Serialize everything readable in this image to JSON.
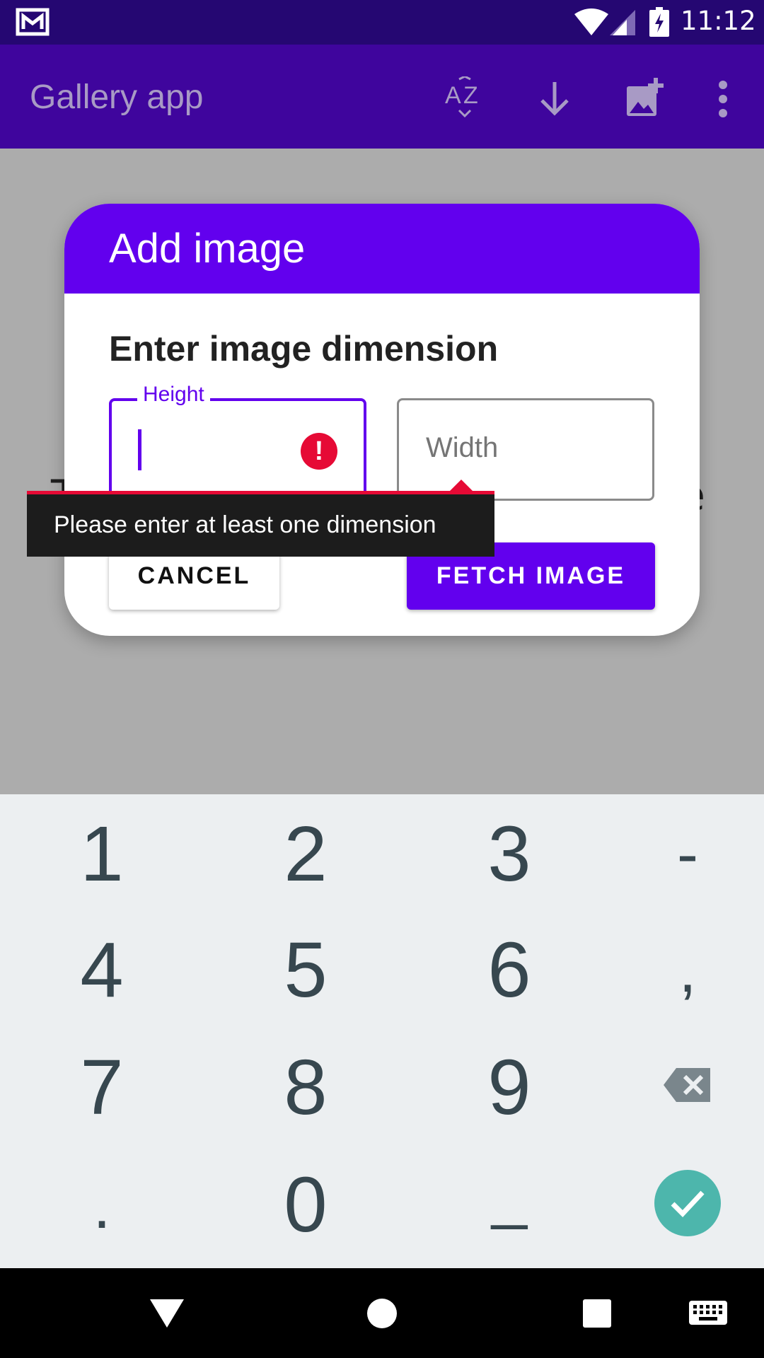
{
  "status_bar": {
    "time": "11:12"
  },
  "app_bar": {
    "title": "Gallery app",
    "actions": [
      "sort-az-icon",
      "download-icon",
      "add-image-icon",
      "more-vert-icon"
    ]
  },
  "background": {
    "left_fragment": "T",
    "right_fragment": "e"
  },
  "dialog": {
    "title": "Add image",
    "subtitle": "Enter image dimension",
    "height_field": {
      "label": "Height",
      "value": ""
    },
    "width_field": {
      "placeholder": "Width",
      "value": ""
    },
    "cancel_label": "CANCEL",
    "fetch_label": "FETCH IMAGE"
  },
  "error_tooltip": {
    "text": "Please enter at least one dimension"
  },
  "keyboard": {
    "rows": [
      [
        "1",
        "2",
        "3",
        "-"
      ],
      [
        "4",
        "5",
        "6",
        ","
      ],
      [
        "7",
        "8",
        "9",
        "backspace-icon"
      ],
      [
        ".",
        "0",
        "_",
        "done-icon"
      ]
    ]
  },
  "nav_bar": [
    "back-icon",
    "home-icon",
    "recents-icon",
    "keyboard-icon"
  ],
  "colors": {
    "primary": "#6200ee",
    "status_bar": "#250772",
    "error": "#e60a35",
    "done_key": "#4db6ac"
  }
}
